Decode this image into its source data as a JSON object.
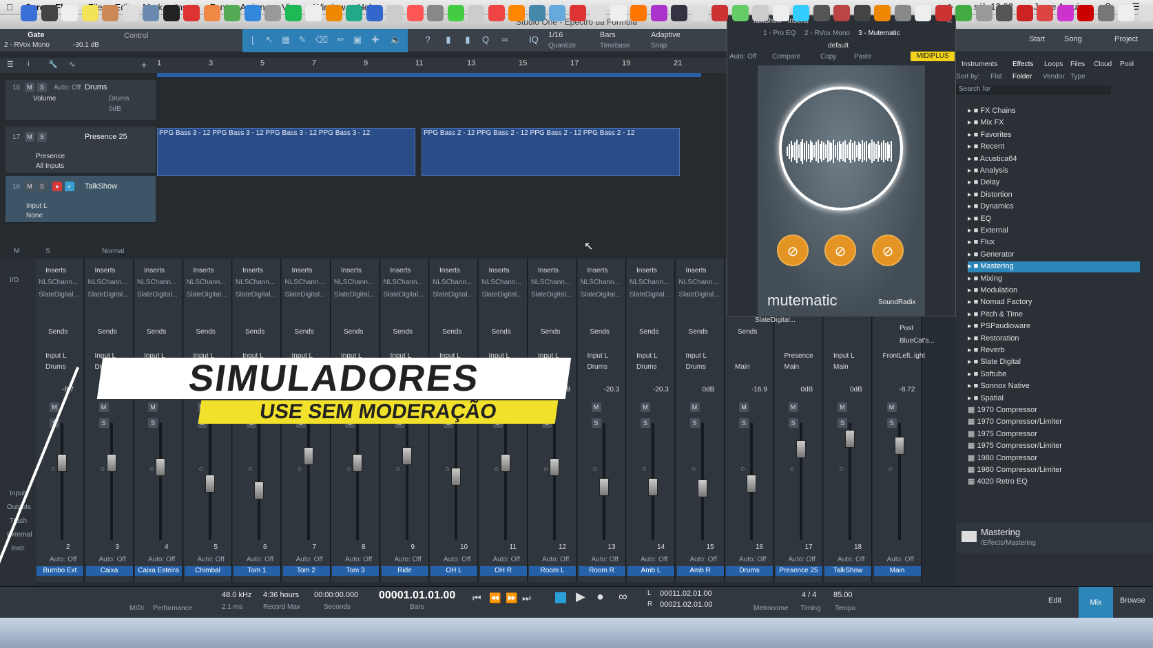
{
  "menubar": {
    "app": "ScreenFlow",
    "items": [
      "File",
      "Edit",
      "Mark",
      "Insert",
      "Font",
      "Actions",
      "View",
      "Window",
      "Help"
    ],
    "clock": "sáb 12:02",
    "user": "Jorge Araujo"
  },
  "window_title": "Studio One - Epectro da Fórmula",
  "toolbar": {
    "gate_label": "Gate",
    "rvox": "2 - RVox Mono",
    "gate_value": "-30.1 dB",
    "control": "Control",
    "quantize_value": "1/16",
    "quantize_label": "Quantize",
    "timebase_value": "Bars",
    "timebase_label": "Timebase",
    "snap_value": "Adaptive",
    "snap_label": "Snap",
    "start": "Start",
    "song": "Song",
    "project": "Project"
  },
  "ruler": [
    "1",
    "3",
    "5",
    "7",
    "9",
    "11",
    "13",
    "15",
    "17",
    "19",
    "21"
  ],
  "tracks": [
    {
      "num": "16",
      "name": "Drums",
      "sub1": "Volume",
      "sub2": "Drums",
      "sub3": "0dB",
      "auto": "Auto: Off"
    },
    {
      "num": "17",
      "name": "Presence 25",
      "sub1": "Presence",
      "sub2": "All Inputs"
    },
    {
      "num": "18",
      "name": "TalkShow",
      "sub1": "Input L",
      "sub2": "None"
    }
  ],
  "clips": {
    "bass3": [
      "PPG Bass 3 - 12",
      "PPG Bass 3 - 12",
      "PPG Bass 3 - 12",
      "PPG Bass 3 - 12"
    ],
    "bass2": [
      "PPG Bass 2 - 12",
      "PPG Bass 2 - 12",
      "PPG Bass 2 - 12",
      "PPG Bass 2 - 12"
    ]
  },
  "track_footer": {
    "m": "M",
    "s": "S",
    "mode": "Normal"
  },
  "plugin": {
    "title": "TalkShow - Inserts",
    "tabs": [
      "1 - Pro EQ",
      "2 - RVox Mono",
      "3 - Mutematic"
    ],
    "auto": "Auto: Off",
    "compare": "Compare",
    "copy": "Copy",
    "paste": "Paste",
    "preset": "default",
    "badge": "MIDIPLUS",
    "brand": "mutematic",
    "vendor": "SoundRadix"
  },
  "browser": {
    "tabs": [
      "Instruments",
      "Effects",
      "Loops",
      "Files",
      "Cloud",
      "Pool"
    ],
    "sort_by": "Sort by:",
    "sort_opts": [
      "Flat",
      "Folder",
      "Vendor",
      "Type"
    ],
    "search": "Search for",
    "items": [
      "FX Chains",
      "Mix FX",
      "Favorites",
      "Recent",
      "Acustica64",
      "Analysis",
      "Delay",
      "Distortion",
      "Dynamics",
      "EQ",
      "External",
      "Flux",
      "Generator",
      "Mastering",
      "Mixing",
      "Modulation",
      "Nomad Factory",
      "Pitch & Time",
      "PSPaudioware",
      "Restoration",
      "Reverb",
      "Slate Digital",
      "Softube",
      "Sonnox Native",
      "Spatial",
      "1970 Compressor",
      "1970 Compressor/Limiter",
      "1975 Compressor",
      "1975 Compressor/Limiter",
      "1980 Compressor",
      "1980 Compressor/Limiter",
      "4020 Retro EQ"
    ],
    "selected": "Mastering",
    "footer_title": "Mastering",
    "footer_path": "/Effects/Mastering"
  },
  "mixer": {
    "inserts_label": "Inserts",
    "plugin_a": "NLSChann...",
    "plugin_b": "SlateDigital...",
    "sends_label": "Sends",
    "left_labels": [
      "I/O",
      "Inputs",
      "Outputs",
      "Trash",
      "External",
      "Instr."
    ],
    "channels": [
      {
        "n": "2",
        "name": "Bumbo Ext",
        "input": "Input L",
        "out": "Drums",
        "db": "-8.7"
      },
      {
        "n": "3",
        "name": "Caixa",
        "input": "Input L",
        "out": "Drums",
        "db": ""
      },
      {
        "n": "4",
        "name": "Caixa Esteira",
        "input": "Input L",
        "out": "Drums",
        "db": ""
      },
      {
        "n": "5",
        "name": "Chimbal",
        "input": "Input L",
        "out": "Drums",
        "db": ""
      },
      {
        "n": "6",
        "name": "Tom 1",
        "input": "Input L",
        "out": "Drums",
        "db": ""
      },
      {
        "n": "7",
        "name": "Tom 2",
        "input": "Input L",
        "out": "Drums",
        "db": ""
      },
      {
        "n": "8",
        "name": "Tom 3",
        "input": "Input L",
        "out": "Drums",
        "db": ""
      },
      {
        "n": "9",
        "name": "Ride",
        "input": "Input L",
        "out": "Drums",
        "db": ""
      },
      {
        "n": "10",
        "name": "OH L",
        "input": "Input L",
        "out": "Drums",
        "db": ""
      },
      {
        "n": "11",
        "name": "OH R",
        "input": "Input L",
        "out": "Drums",
        "db": "9.9"
      },
      {
        "n": "12",
        "name": "Room L",
        "input": "Input L",
        "out": "Drums",
        "db": "-19.9"
      },
      {
        "n": "13",
        "name": "Room R",
        "input": "Input L",
        "out": "Drums",
        "db": "-20.3"
      },
      {
        "n": "14",
        "name": "Amb L",
        "input": "Input L",
        "out": "Drums",
        "db": "-20.3"
      },
      {
        "n": "15",
        "name": "Amb R",
        "input": "Input L",
        "out": "Drums",
        "db": "0dB"
      },
      {
        "n": "16",
        "name": "Drums",
        "input": "",
        "out": "Main",
        "db": "-16.9"
      },
      {
        "n": "17",
        "name": "Presence 25",
        "input": "Presence",
        "out": "Main",
        "db": "0dB"
      },
      {
        "n": "18",
        "name": "TalkShow",
        "input": "Input L",
        "out": "Main",
        "db": "0dB"
      },
      {
        "n": "",
        "name": "Main",
        "input": "FrontLeft..ight",
        "out": "",
        "db": "-8.72"
      }
    ],
    "post": "Post",
    "bluecat": "BlueCat's...",
    "slate": "SlateDigital...",
    "auto_off": "Auto: Off"
  },
  "banner": {
    "title": "SIMULADORES",
    "subtitle": "USE SEM MODERAÇÃO"
  },
  "transport": {
    "midi": "MIDI",
    "performance": "Performance",
    "rate": "48.0 kHz",
    "latency": "2.1 ms",
    "record_time": "4:36 hours",
    "record_max": "Record Max",
    "seconds": "00:00:00.000",
    "seconds_label": "Seconds",
    "bars": "00001.01.01.00",
    "bars_label": "Bars",
    "loop_l": "00011.02.01.00",
    "loop_r": "00021.02.01.00",
    "timing": "4 / 4",
    "timing_label": "Timing",
    "metronome_label": "Metronome",
    "tempo": "85.00",
    "tempo_label": "Tempo",
    "edit": "Edit",
    "mix": "Mix",
    "browse": "Browse"
  },
  "colors": {
    "accent": "#2d86b8",
    "clip": "#2a4d88",
    "orange": "#e39422",
    "banner_yellow": "#f2e12a"
  }
}
